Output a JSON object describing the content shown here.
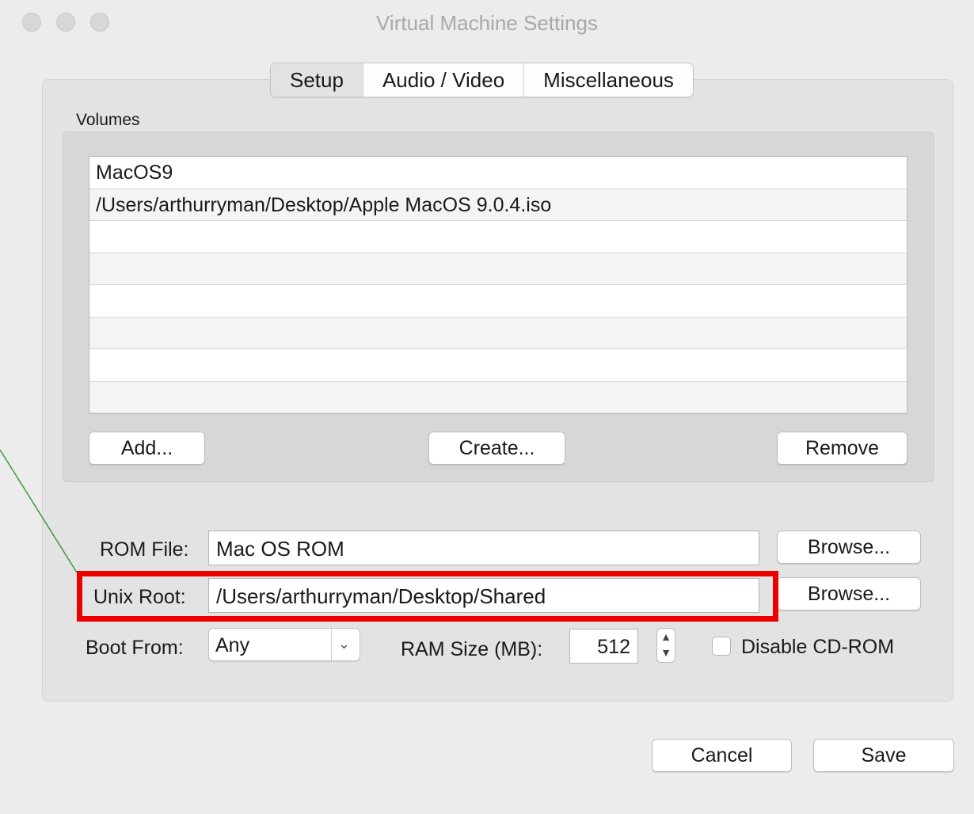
{
  "window": {
    "title": "Virtual Machine Settings"
  },
  "tabs": [
    {
      "label": "Setup",
      "active": true
    },
    {
      "label": "Audio / Video",
      "active": false
    },
    {
      "label": "Miscellaneous",
      "active": false
    }
  ],
  "volumes": {
    "label": "Volumes",
    "items": [
      "MacOS9",
      "/Users/arthurryman/Desktop/Apple MacOS 9.0.4.iso",
      "",
      "",
      "",
      "",
      "",
      ""
    ],
    "add_label": "Add...",
    "create_label": "Create...",
    "remove_label": "Remove"
  },
  "rom": {
    "label": "ROM File:",
    "value": "Mac OS ROM",
    "browse_label": "Browse..."
  },
  "unix_root": {
    "label": "Unix Root:",
    "value": "/Users/arthurryman/Desktop/Shared",
    "browse_label": "Browse..."
  },
  "boot": {
    "label": "Boot From:",
    "value": "Any"
  },
  "ram": {
    "label": "RAM Size (MB):",
    "value": "512"
  },
  "cdrom": {
    "label": "Disable CD-ROM",
    "checked": false
  },
  "footer": {
    "cancel_label": "Cancel",
    "save_label": "Save"
  },
  "colors": {
    "highlight": "#ee0000",
    "annotation_line": "#3a9a3a"
  }
}
